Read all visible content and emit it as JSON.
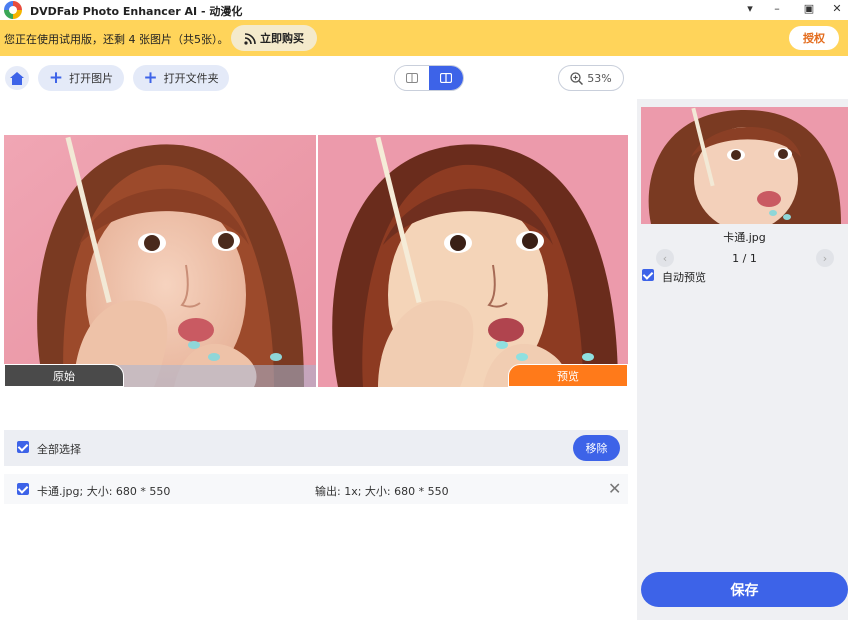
{
  "window": {
    "title": "DVDFab Photo Enhancer AI - 动漫化",
    "controls": [
      "menu-down",
      "minimize",
      "maximize",
      "close"
    ]
  },
  "banner": {
    "trial_text": "您正在使用试用版，还剩 4 张图片（共5张）。",
    "buy_label": "立即购买",
    "auth_label": "授权"
  },
  "toolbar": {
    "add_image_label": "打开图片",
    "add_folder_label": "打开文件夹",
    "zoom": "53%"
  },
  "compare": {
    "original_label": "原始",
    "preview_label": "预览"
  },
  "list": {
    "select_all_label": "全部选择",
    "remove_label": "移除",
    "files": [
      {
        "name": "卡通.jpg; 大小: 680 * 550",
        "output": "输出: 1x; 大小: 680 * 550"
      }
    ]
  },
  "sidebar": {
    "thumb_name": "卡通.jpg",
    "page_indicator": "1 / 1",
    "auto_preview_label": "自动预览",
    "save_label": "保存"
  },
  "colors": {
    "accent": "#3d63e8",
    "banner": "#ffd45a",
    "preview_tag": "#ff7a1a",
    "auth_text": "#e36b1b"
  }
}
